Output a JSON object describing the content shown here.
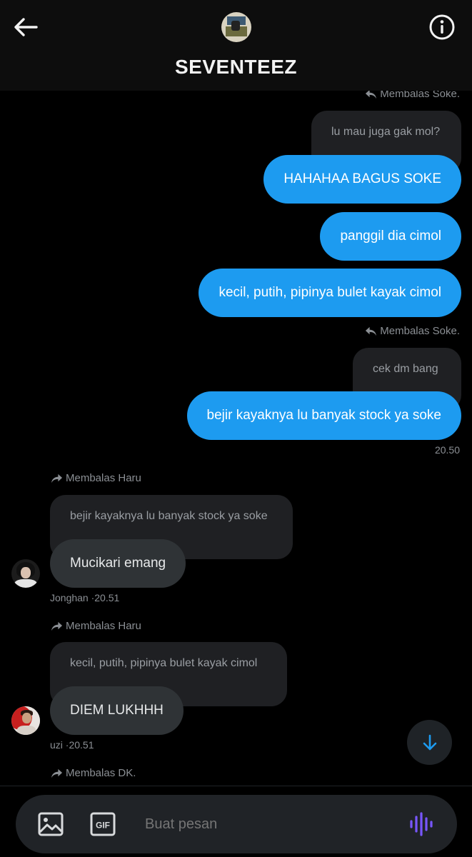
{
  "header": {
    "title": "SEVENTEEZ"
  },
  "messages": {
    "m1_reply_label": "Membalas Soke.",
    "m1_quote": "lu mau juga gak mol?",
    "m1_bubbles": [
      "HAHAHAA BAGUS SOKE",
      "panggil dia cimol",
      "kecil, putih, pipinya bulet kayak cimol"
    ],
    "m2_reply_label": "Membalas Soke.",
    "m2_quote": "cek dm bang",
    "m2_bubble": "bejir kayaknya lu banyak stock ya soke",
    "m2_time": "20.50",
    "m3_reply_label": "Membalas Haru",
    "m3_quote": "bejir kayaknya lu banyak stock ya soke",
    "m3_bubble": "Mucikari emang",
    "m3_meta": "Jonghan ·20.51",
    "m4_reply_label": "Membalas Haru",
    "m4_quote": "kecil, putih, pipinya bulet kayak cimol",
    "m4_bubble": "DIEM LUKHHH",
    "m4_meta": "uzi ·20.51",
    "m5_reply_label": "Membalas DK."
  },
  "composer": {
    "placeholder": "Buat pesan",
    "gif_label": "GIF"
  },
  "colors": {
    "accent": "#1d9bf0",
    "voice": "#7856ff",
    "background": "#000000"
  },
  "icons": [
    "back-arrow-icon",
    "info-icon",
    "reply-icon",
    "forward-icon",
    "arrow-down-icon",
    "image-icon",
    "gif-icon",
    "voice-icon"
  ]
}
